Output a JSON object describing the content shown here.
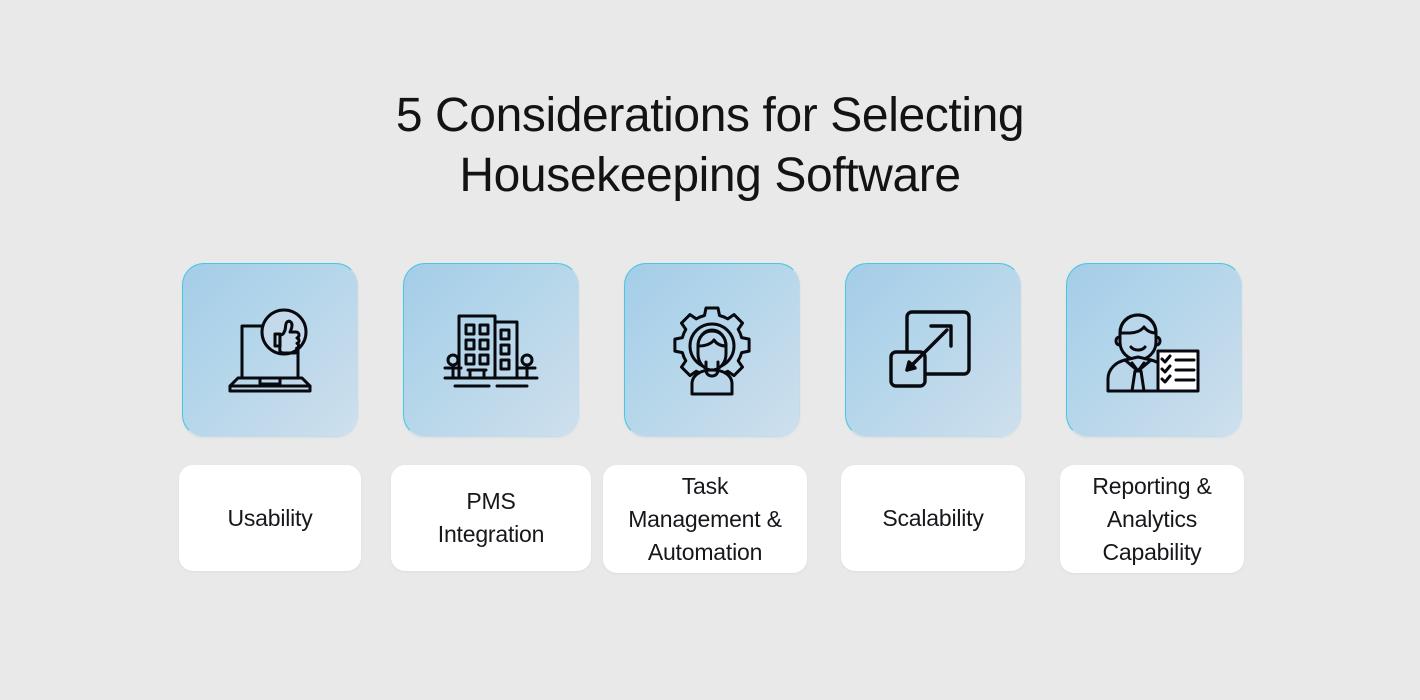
{
  "page": {
    "background_color": "#e9e9e9",
    "title_lines": [
      "5 Considerations for Selecting",
      "Housekeeping Software"
    ],
    "title_color": "#131313"
  },
  "theme": {
    "tile_gradient_start": "#a4cde8",
    "tile_gradient_end": "#cde0ee",
    "tile_border_accent": "#49c6e0",
    "label_card_background": "#ffffff",
    "label_text_color": "#15171a",
    "icon_stroke_color": "#07090f"
  },
  "items": [
    {
      "index": "1",
      "icon_name": "laptop-thumbs-up-icon",
      "label": "Usability"
    },
    {
      "index": "2",
      "icon_name": "hotel-building-icon",
      "label": "PMS\nIntegration"
    },
    {
      "index": "3",
      "icon_name": "person-gear-icon",
      "label": "Task\nManagement &\nAutomation"
    },
    {
      "index": "4",
      "icon_name": "expand-arrow-squares-icon",
      "label": "Scalability"
    },
    {
      "index": "5",
      "icon_name": "businessman-checklist-icon",
      "label": "Reporting &\nAnalytics\nCapability"
    }
  ]
}
